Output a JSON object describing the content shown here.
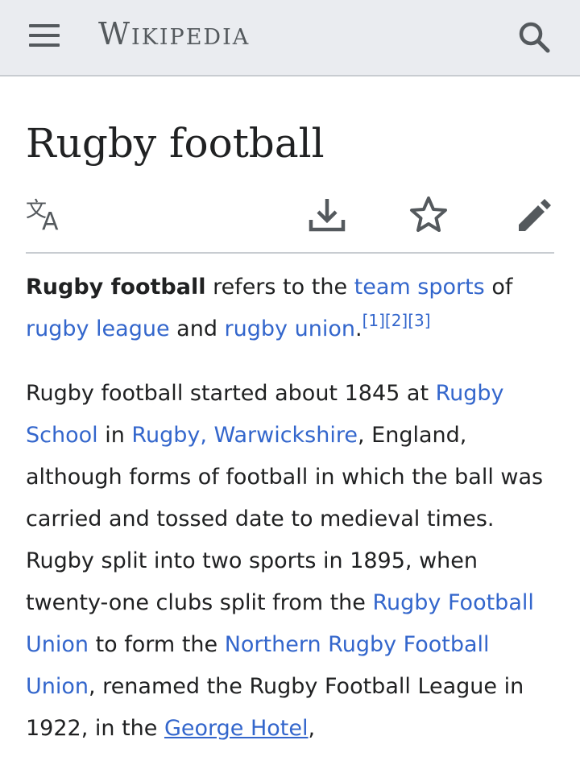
{
  "header": {
    "logo_text": "Wikipedia"
  },
  "article": {
    "title": "Rugby football",
    "p1": {
      "bold": "Rugby football",
      "t1": " refers to the ",
      "link_team_sports": "team sports",
      "t2": " of ",
      "link_rugby_league": "rugby league",
      "t3": " and ",
      "link_rugby_union": "rugby union",
      "t4": ".",
      "refs": [
        "[1]",
        "[2]",
        "[3]"
      ]
    },
    "p2": {
      "t1": "Rugby football started about 1845 at ",
      "link_rugby_school": "Rugby School",
      "t2": " in ",
      "link_rugby_warwickshire": "Rugby, Warwickshire",
      "t3": ", England, although forms of football in which the ball was carried and tossed date to medieval times. Rugby split into two sports in 1895, when twenty-one clubs split from the ",
      "link_rfu": "Rugby Football Union",
      "t4": " to form the ",
      "link_nrfu": "Northern Rugby Football Union",
      "t5": ", renamed the Rugby Football League in 1922, in the ",
      "link_george_hotel": "George Hotel",
      "t6": ","
    }
  },
  "colors": {
    "link": "#3366cc",
    "text": "#202122",
    "header_bg": "#eaecf0",
    "icon": "#54595d"
  },
  "icons": [
    "menu-icon",
    "search-icon",
    "language-icon",
    "download-icon",
    "star-icon",
    "edit-icon"
  ]
}
